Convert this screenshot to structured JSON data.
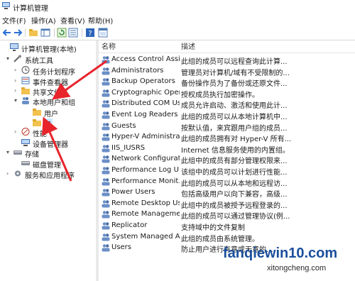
{
  "window": {
    "title": "计算机管理",
    "icon": "computer-management-icon"
  },
  "menu": [
    "文件(F)",
    "操作(A)",
    "查看(V)",
    "帮助(H)"
  ],
  "toolbar_icons": [
    "back-icon",
    "forward-icon",
    "up-folder-icon",
    "show-hide-tree-icon",
    "refresh-icon",
    "export-list-icon",
    "help-icon",
    "properties-icon"
  ],
  "tree": [
    {
      "label": "计算机管理(本地)",
      "icon": "computer-icon",
      "toggle": ""
    },
    {
      "label": "系统工具",
      "icon": "tools-icon",
      "toggle": "▾"
    },
    {
      "label": "任务计划程序",
      "icon": "clock-icon",
      "toggle": "›"
    },
    {
      "label": "事件查看器",
      "icon": "event-viewer-icon",
      "toggle": "›"
    },
    {
      "label": "共享文件夹",
      "icon": "shared-folder-icon",
      "toggle": "›"
    },
    {
      "label": "本地用户和组",
      "icon": "users-icon",
      "toggle": "▾"
    },
    {
      "label": "用户",
      "icon": "folder-icon",
      "toggle": ""
    },
    {
      "label": "组",
      "icon": "folder-icon",
      "toggle": ""
    },
    {
      "label": "性能",
      "icon": "performance-icon",
      "toggle": "›"
    },
    {
      "label": "设备管理器",
      "icon": "device-manager-icon",
      "toggle": ""
    },
    {
      "label": "存储",
      "icon": "storage-icon",
      "toggle": "▾"
    },
    {
      "label": "磁盘管理",
      "icon": "disk-icon",
      "toggle": ""
    },
    {
      "label": "服务和应用程序",
      "icon": "services-icon",
      "toggle": "›"
    }
  ],
  "columns": {
    "name": "名称",
    "description": "描述"
  },
  "groups": [
    {
      "name": "Access Control Assi...",
      "desc": "此组的成员可以远程查询此计算..."
    },
    {
      "name": "Administrators",
      "desc": "管理员对计算机/域有不受限制的..."
    },
    {
      "name": "Backup Operators",
      "desc": "备份操作员为了备份或还原文件..."
    },
    {
      "name": "Cryptographic Oper...",
      "desc": "授权成员执行加密操作。"
    },
    {
      "name": "Distributed COM Us...",
      "desc": "成员允许启动、激活和使用此计..."
    },
    {
      "name": "Event Log Readers",
      "desc": "此组的成员可以从本地计算机中..."
    },
    {
      "name": "Guests",
      "desc": "按默认值，来宾跟用户组的成员..."
    },
    {
      "name": "Hyper-V Administra...",
      "desc": "此组的成员拥有对 Hyper-V 所有..."
    },
    {
      "name": "IIS_IUSRS",
      "desc": "Internet 信息服务使用的内置组。"
    },
    {
      "name": "Network Configurat...",
      "desc": "此组中的成员有部分管理权限来..."
    },
    {
      "name": "Performance Log U...",
      "desc": "该组中的成员可以计划进行性能..."
    },
    {
      "name": "Performance Monit...",
      "desc": "此组的成员可以从本地和远程访..."
    },
    {
      "name": "Power Users",
      "desc": "包括高级用户以向下兼容，高级..."
    },
    {
      "name": "Remote Desktop Us...",
      "desc": "此组中的成员被授予远程登录的..."
    },
    {
      "name": "Remote Manageme...",
      "desc": "此组的成员可以通过管理协议(例..."
    },
    {
      "name": "Replicator",
      "desc": "支持域中的文件复制"
    },
    {
      "name": "System Managed A...",
      "desc": "此组的成员由系统管理。"
    },
    {
      "name": "Users",
      "desc": "防止用户进行有意或无意的..."
    }
  ],
  "watermark": {
    "main": "fanqiewin10.com",
    "sub": "xitongcheng.com"
  },
  "colors": {
    "arrow": "#e8242b",
    "selection": "#cce8ff",
    "folder": "#f2c14e",
    "group_icon": "#6b8fc7"
  }
}
